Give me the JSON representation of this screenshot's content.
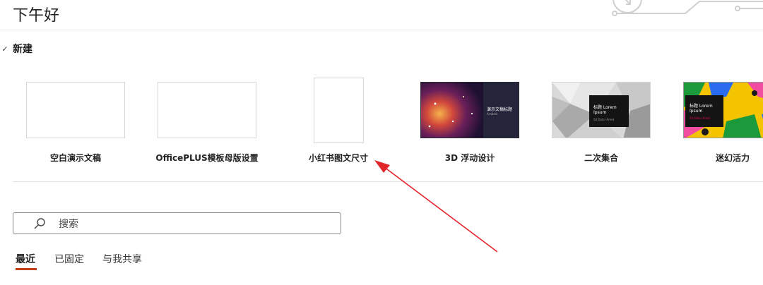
{
  "greeting": "下午好",
  "new_section": {
    "chevron": "✓",
    "title": "新建"
  },
  "templates": [
    {
      "label": "空白演示文稿",
      "thumb_type": "blank-wide"
    },
    {
      "label": "OfficePLUS模板母版设置",
      "thumb_type": "blank-wide"
    },
    {
      "label": "小红书图文尺寸",
      "thumb_type": "blank-portrait"
    },
    {
      "label": "3D 浮动设计",
      "thumb_type": "galaxy",
      "thumb_title": "演示文稿标题",
      "thumb_sub": "Arabela"
    },
    {
      "label": "二次集合",
      "thumb_type": "geometric",
      "thumb_title": "标题 Lorem Ipsum",
      "thumb_sub": "Sit Dolor Amet"
    },
    {
      "label": "迷幻活力",
      "thumb_type": "psychedelic",
      "thumb_title": "标题 Lorem Ipsum",
      "thumb_sub": "Sit Dolor Amet"
    }
  ],
  "search": {
    "placeholder": "搜索"
  },
  "tabs": [
    {
      "label": "最近",
      "active": true
    },
    {
      "label": "已固定",
      "active": false
    },
    {
      "label": "与我共享",
      "active": false
    }
  ],
  "colors": {
    "accent": "#c43e1c",
    "annotation_arrow": "#e0262a"
  }
}
